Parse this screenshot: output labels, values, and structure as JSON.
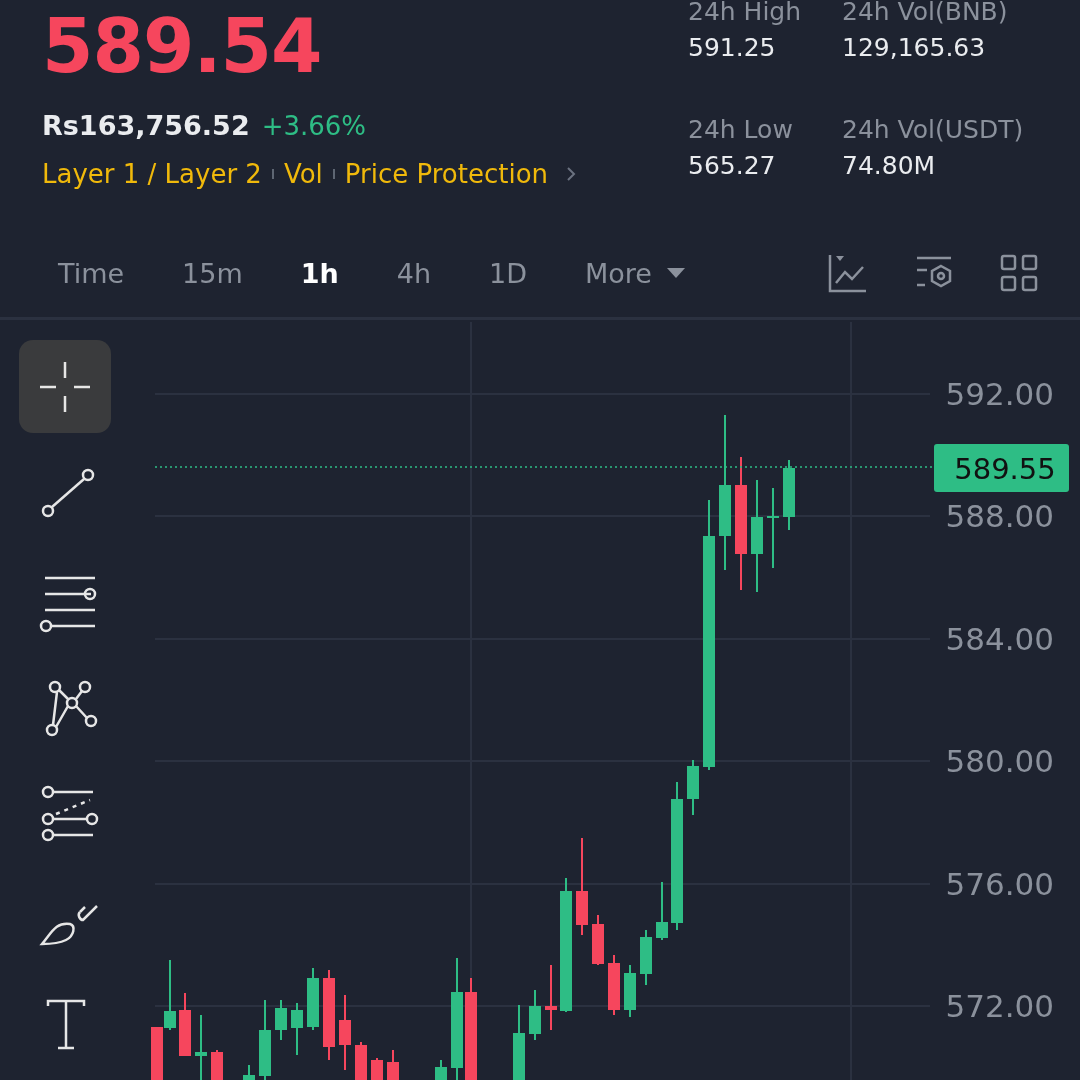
{
  "ticker": {
    "last_price": "589.54",
    "fiat_price": "Rs163,756.52",
    "change": "+3.66%",
    "tags": [
      "Layer 1 / Layer 2",
      "Vol",
      "Price Protection"
    ]
  },
  "stats": [
    {
      "label": "24h High",
      "value": "591.25"
    },
    {
      "label": "24h Vol(BNB)",
      "value": "129,165.63"
    },
    {
      "label": "24h Low",
      "value": "565.27"
    },
    {
      "label": "24h Vol(USDT)",
      "value": "74.80M"
    }
  ],
  "intervals": [
    {
      "label": "Time",
      "selected": false,
      "kind": "plain"
    },
    {
      "label": "15m",
      "selected": false,
      "kind": "plain"
    },
    {
      "label": "1h",
      "selected": true,
      "kind": "plain"
    },
    {
      "label": "4h",
      "selected": false,
      "kind": "plain"
    },
    {
      "label": "1D",
      "selected": false,
      "kind": "plain"
    },
    {
      "label": "More",
      "selected": false,
      "kind": "dropdown"
    }
  ],
  "tools": [
    {
      "kind": "crosshair",
      "selected": true
    },
    {
      "kind": "trendline",
      "selected": false
    },
    {
      "kind": "hlines",
      "selected": false
    },
    {
      "kind": "pattern",
      "selected": false
    },
    {
      "kind": "channel",
      "selected": false
    },
    {
      "kind": "brush",
      "selected": false
    },
    {
      "kind": "text",
      "selected": false
    }
  ],
  "chart": {
    "y_labels": [
      "592.00",
      "588.00",
      "584.00",
      "580.00",
      "576.00",
      "572.00"
    ],
    "last_price_tag": "589.55"
  }
}
